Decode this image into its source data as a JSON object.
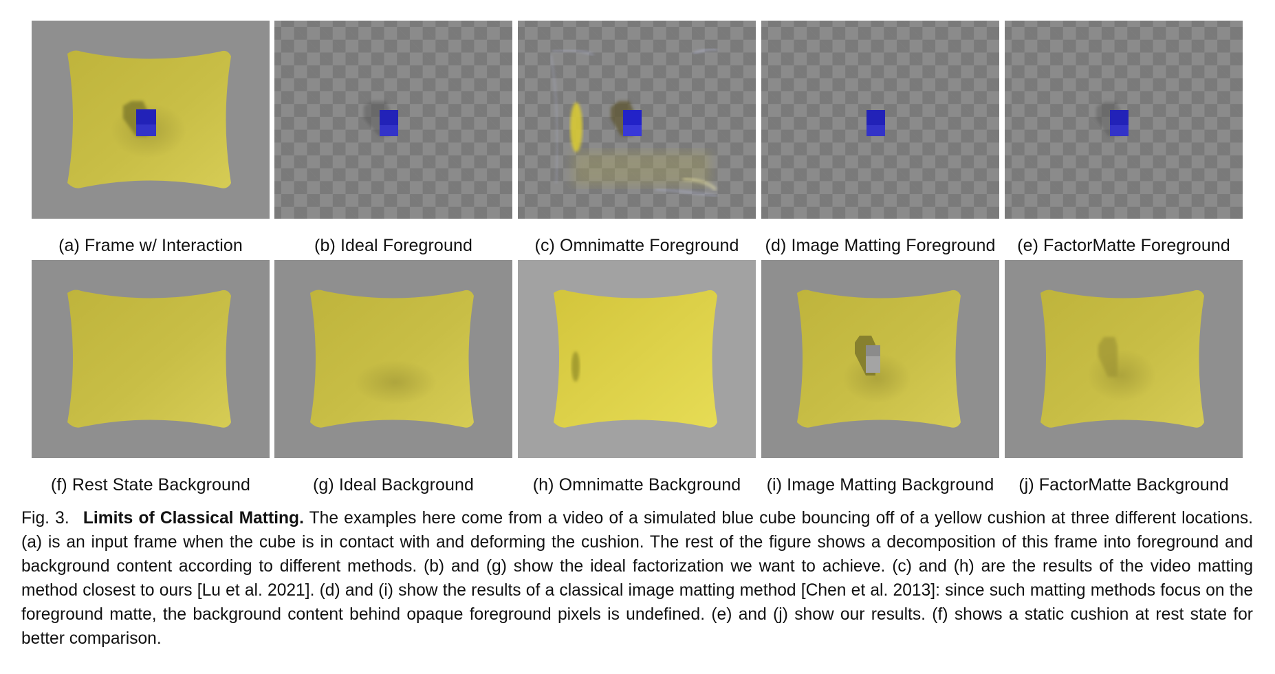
{
  "figure": {
    "number_label": "Fig. 3.",
    "title": "Limits of Classical Matting.",
    "body": "The examples here come from a video of a simulated blue cube bouncing off of a yellow cushion at three different locations. (a) is an input frame when the cube is in contact with and deforming the cushion. The rest of the figure shows a decomposition of this frame into foreground and background content according to different methods. (b) and (g) show the ideal factorization we want to achieve. (c) and (h) are the results of the video matting method closest to ours [Lu et al. 2021]. (d) and (i) show the results of a classical image matting method [Chen et al. 2013]: since such matting methods focus on the foreground matte, the background content behind opaque foreground pixels is undefined. (e) and (j) show our results. (f) shows a static cushion at rest state for better comparison."
  },
  "colors": {
    "scene_background": "#8f8f8f",
    "omnimatte_background": "#a2a2a2",
    "cushion_yellow": "#c9bf45",
    "cube_blue": "#2323c0",
    "checker_light": "#8b8b8b",
    "checker_dark": "#7a7a7a"
  },
  "panels": [
    {
      "id": "a",
      "label": "(a) Frame w/ Interaction",
      "content": "cushion-with-cube"
    },
    {
      "id": "b",
      "label": "(b) Ideal Foreground",
      "content": "cube-with-shadow-on-transparency"
    },
    {
      "id": "c",
      "label": "(c) Omnimatte Foreground",
      "content": "cube-with-shadow-and-cushion-artifacts-on-transparency"
    },
    {
      "id": "d",
      "label": "(d) Image Matting Foreground",
      "content": "cube-only-on-transparency"
    },
    {
      "id": "e",
      "label": "(e) FactorMatte Foreground",
      "content": "cube-with-shadow-on-transparency"
    },
    {
      "id": "f",
      "label": "(f) Rest State Background",
      "content": "cushion-at-rest"
    },
    {
      "id": "g",
      "label": "(g) Ideal Background",
      "content": "cushion-with-dent"
    },
    {
      "id": "h",
      "label": "(h) Omnimatte Background",
      "content": "cushion-with-side-artifact"
    },
    {
      "id": "i",
      "label": "(i) Image Matting Background",
      "content": "cushion-with-gray-cube-hole"
    },
    {
      "id": "j",
      "label": "(j) FactorMatte Background",
      "content": "cushion-with-faint-cube-ghost"
    }
  ]
}
